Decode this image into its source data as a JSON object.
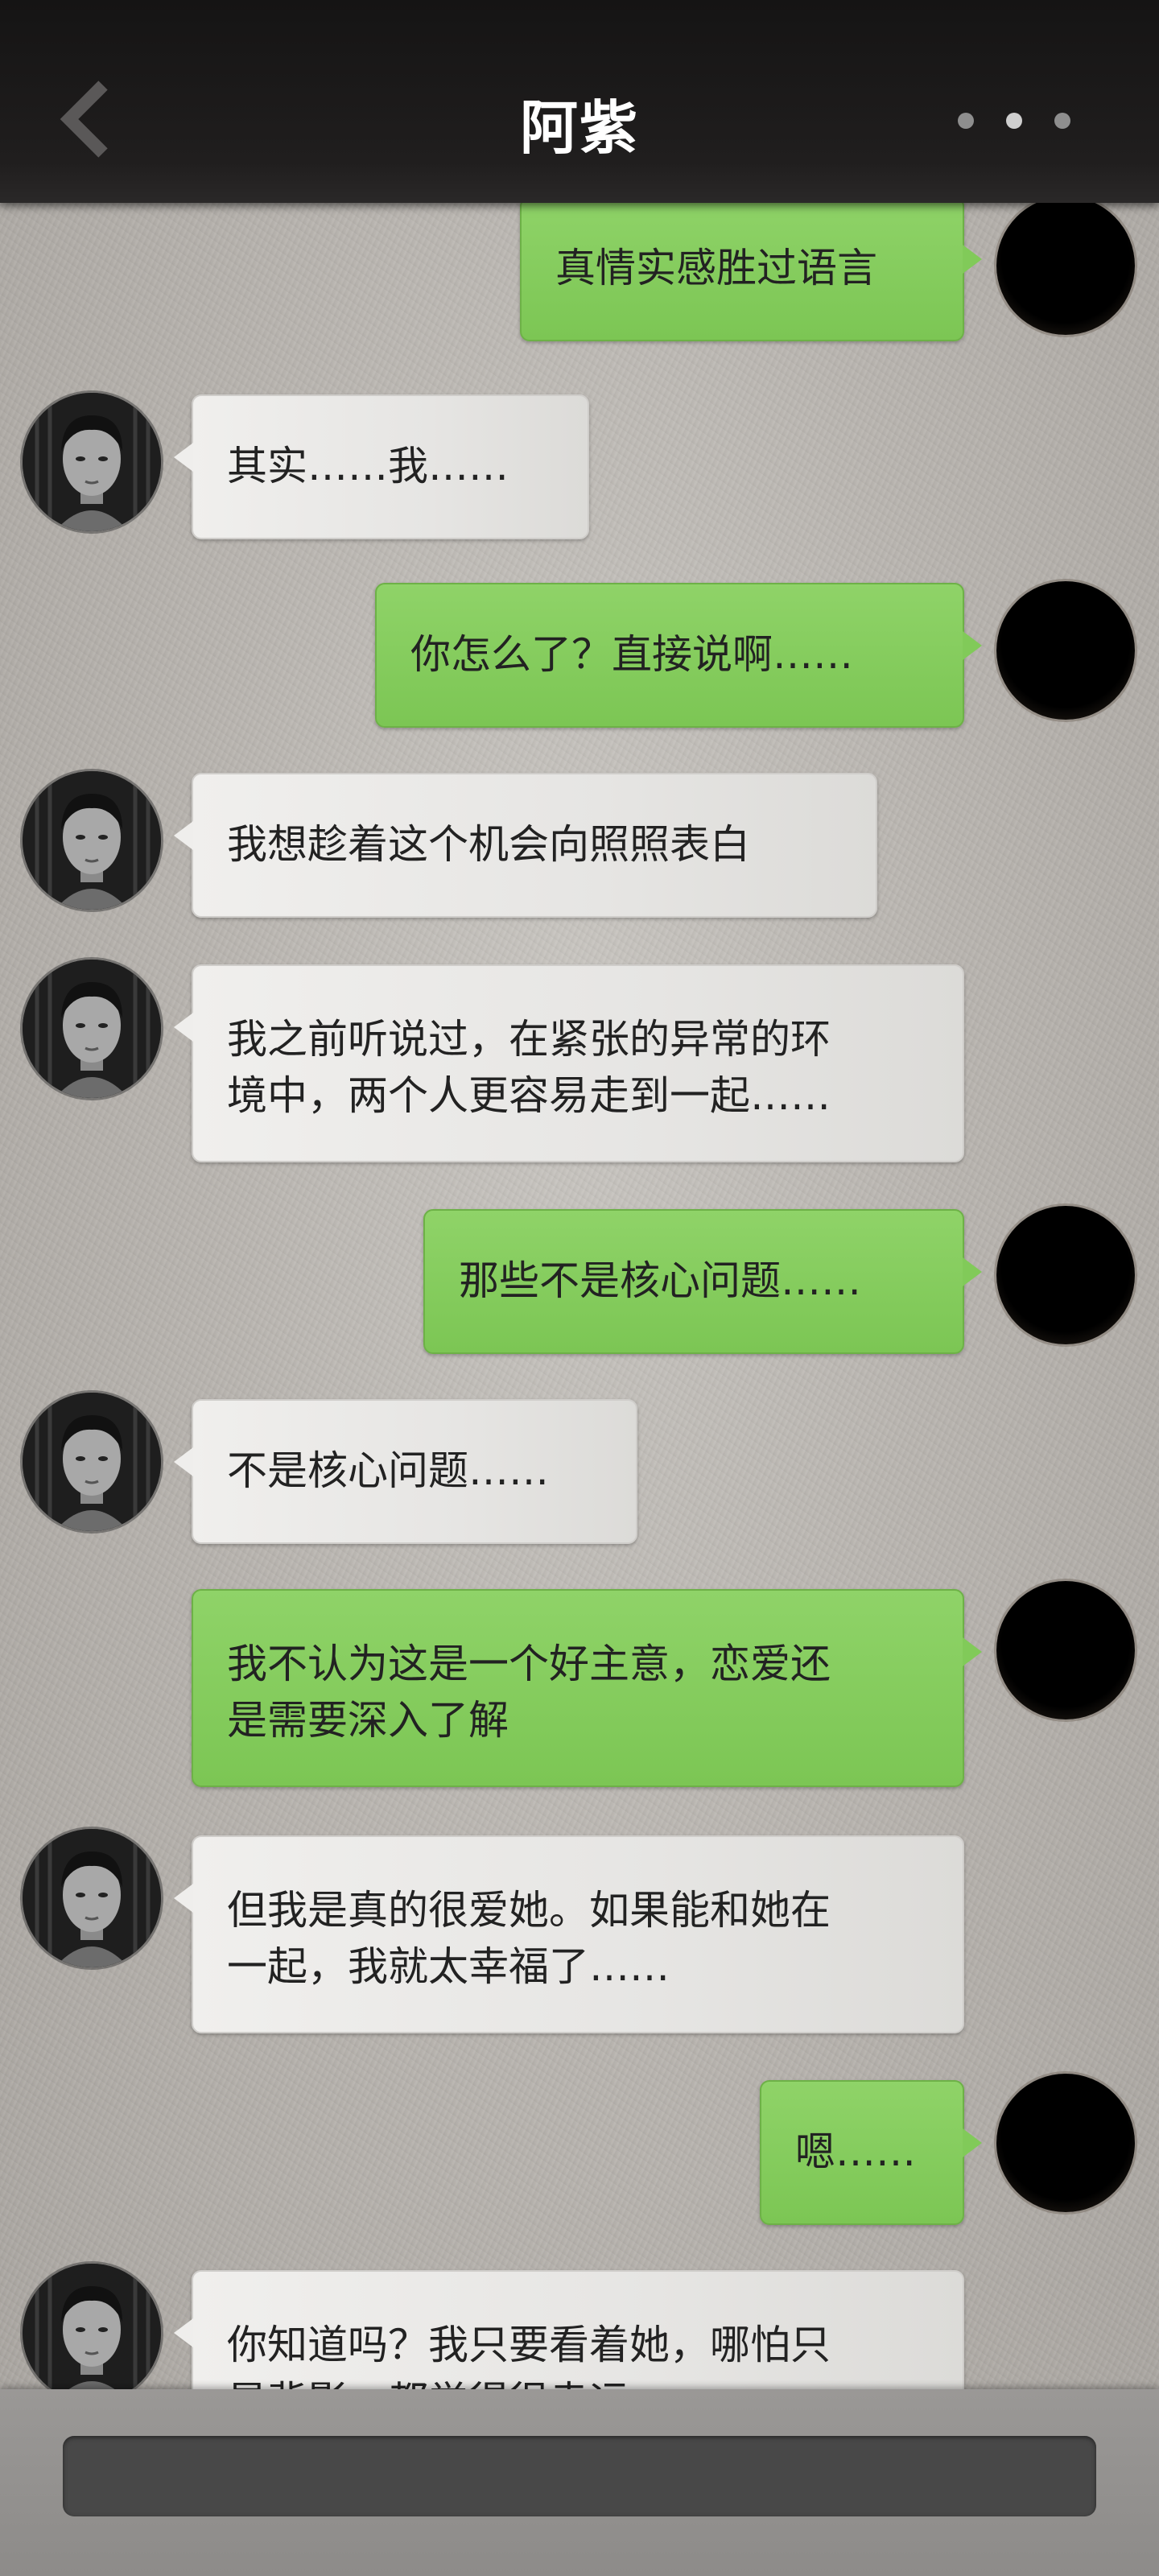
{
  "header": {
    "title": "阿紫"
  },
  "messages": [
    {
      "side": "self",
      "text": "真情实感胜过语言"
    },
    {
      "side": "friend",
      "text": "其实……我……"
    },
    {
      "side": "self",
      "text": "你怎么了？直接说啊……"
    },
    {
      "side": "friend",
      "text": "我想趁着这个机会向照照表白"
    },
    {
      "side": "friend",
      "lines": [
        "我之前听说过，在紧张的异常的环",
        "境中，两个人更容易走到一起……"
      ]
    },
    {
      "side": "self",
      "text": "那些不是核心问题……"
    },
    {
      "side": "friend",
      "text": "不是核心问题……"
    },
    {
      "side": "self",
      "lines": [
        "我不认为这是一个好主意，恋爱还",
        "是需要深入了解"
      ]
    },
    {
      "side": "friend",
      "lines": [
        "但我是真的很爱她。如果能和她在",
        "一起，我就太幸福了……"
      ]
    },
    {
      "side": "self",
      "text": "嗯……"
    },
    {
      "side": "friend",
      "lines": [
        "你知道吗？我只要看着她，哪怕只",
        "是背影，都觉得很幸运……"
      ]
    }
  ],
  "input": {
    "placeholder": ""
  }
}
